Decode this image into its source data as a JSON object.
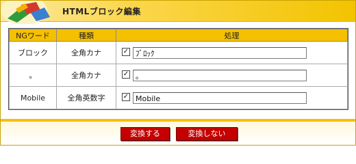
{
  "header": {
    "title": "HTMLブロック編集"
  },
  "table": {
    "columns": [
      "NGワード",
      "種類",
      "処理"
    ],
    "rows": [
      {
        "word": "ブロック",
        "kind": "全角カナ",
        "checked": true,
        "value": "ﾌﾞﾛｯｸ"
      },
      {
        "word": "。",
        "kind": "全角カナ",
        "checked": true,
        "value": "｡"
      },
      {
        "word": "Mobile",
        "kind": "全角英数字",
        "checked": true,
        "value": "Mobile"
      }
    ]
  },
  "buttons": {
    "convert": "変換する",
    "no_convert": "変換しない"
  },
  "colors": {
    "accent": "#f5c000",
    "button": "#c40000"
  }
}
